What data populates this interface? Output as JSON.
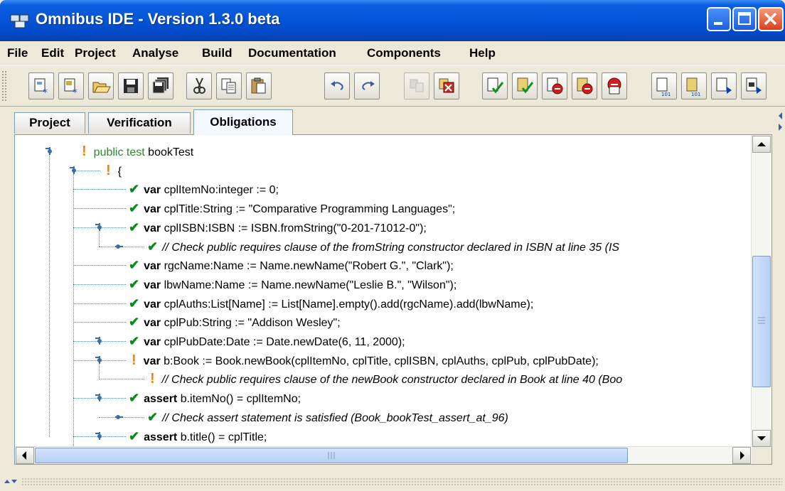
{
  "window": {
    "title": "Omnibus IDE - Version 1.3.0 beta"
  },
  "menu": [
    "File",
    "Edit",
    "Project",
    "Analyse",
    "Build",
    "Documentation",
    "Components",
    "Help"
  ],
  "tabs": [
    {
      "label": "Project",
      "active": false
    },
    {
      "label": "Verification",
      "active": false
    },
    {
      "label": "Obligations",
      "active": true
    }
  ],
  "toolbar_icons": [
    "new-project-icon",
    "new-file-icon",
    "open-icon",
    "save-icon",
    "save-all-icon",
    "cut-icon",
    "copy-icon",
    "paste-icon",
    "undo-icon",
    "redo-icon",
    "disabled-build-icon",
    "clear-errors-icon",
    "check-file-icon",
    "check-all-icon",
    "stop-check-icon",
    "stop-all-icon",
    "error-list-icon",
    "run-file-icon",
    "run-all-icon",
    "run-next-icon",
    "run-more-icon"
  ],
  "tree": [
    {
      "status": "warn",
      "parts": [
        [
          "kw-green",
          "public test"
        ],
        [
          "text",
          " bookTest"
        ]
      ]
    },
    {
      "status": "warn",
      "parts": [
        [
          "text",
          "{"
        ]
      ]
    },
    {
      "status": "ok",
      "parts": [
        [
          "kw",
          "var"
        ],
        [
          "text",
          " cplItemNo:integer := 0;"
        ]
      ]
    },
    {
      "status": "ok",
      "parts": [
        [
          "kw",
          "var"
        ],
        [
          "text",
          " cplTitle:String := \"Comparative Programming Languages\";"
        ]
      ]
    },
    {
      "status": "ok",
      "parts": [
        [
          "kw",
          "var"
        ],
        [
          "text",
          " cplISBN:ISBN := ISBN.fromString(\"0-201-71012-0\");"
        ]
      ]
    },
    {
      "status": "ok",
      "parts": [
        [
          "cmt",
          "// Check public requires clause of the fromString constructor declared in ISBN at line 35 (IS"
        ]
      ]
    },
    {
      "status": "ok",
      "parts": [
        [
          "kw",
          "var"
        ],
        [
          "text",
          " rgcName:Name := Name.newName(\"Robert G.\", \"Clark\");"
        ]
      ]
    },
    {
      "status": "ok",
      "parts": [
        [
          "kw",
          "var"
        ],
        [
          "text",
          " lbwName:Name := Name.newName(\"Leslie B.\", \"Wilson\");"
        ]
      ]
    },
    {
      "status": "ok",
      "parts": [
        [
          "kw",
          "var"
        ],
        [
          "text",
          " cplAuths:List[Name] := List[Name].empty().add(rgcName).add(lbwName);"
        ]
      ]
    },
    {
      "status": "ok",
      "parts": [
        [
          "kw",
          "var"
        ],
        [
          "text",
          " cplPub:String := \"Addison Wesley\";"
        ]
      ]
    },
    {
      "status": "ok",
      "parts": [
        [
          "kw",
          "var"
        ],
        [
          "text",
          " cplPubDate:Date := Date.newDate(6, 11, 2000);"
        ]
      ]
    },
    {
      "status": "warn",
      "parts": [
        [
          "kw",
          "var"
        ],
        [
          "text",
          " b:Book := Book.newBook(cplItemNo, cplTitle, cplISBN, cplAuths, cplPub, cplPubDate);"
        ]
      ]
    },
    {
      "status": "warn",
      "parts": [
        [
          "cmt",
          "// Check public requires clause of the newBook constructor declared in Book at line 40 (Boo"
        ]
      ]
    },
    {
      "status": "ok",
      "parts": [
        [
          "kw",
          "assert"
        ],
        [
          "text",
          " b.itemNo() = cplItemNo;"
        ]
      ]
    },
    {
      "status": "ok",
      "parts": [
        [
          "cmt",
          "// Check assert statement is satisfied (Book_bookTest_assert_at_96)"
        ]
      ]
    },
    {
      "status": "ok",
      "parts": [
        [
          "kw",
          "assert"
        ],
        [
          "text",
          " b.title() = cplTitle;"
        ]
      ]
    }
  ]
}
